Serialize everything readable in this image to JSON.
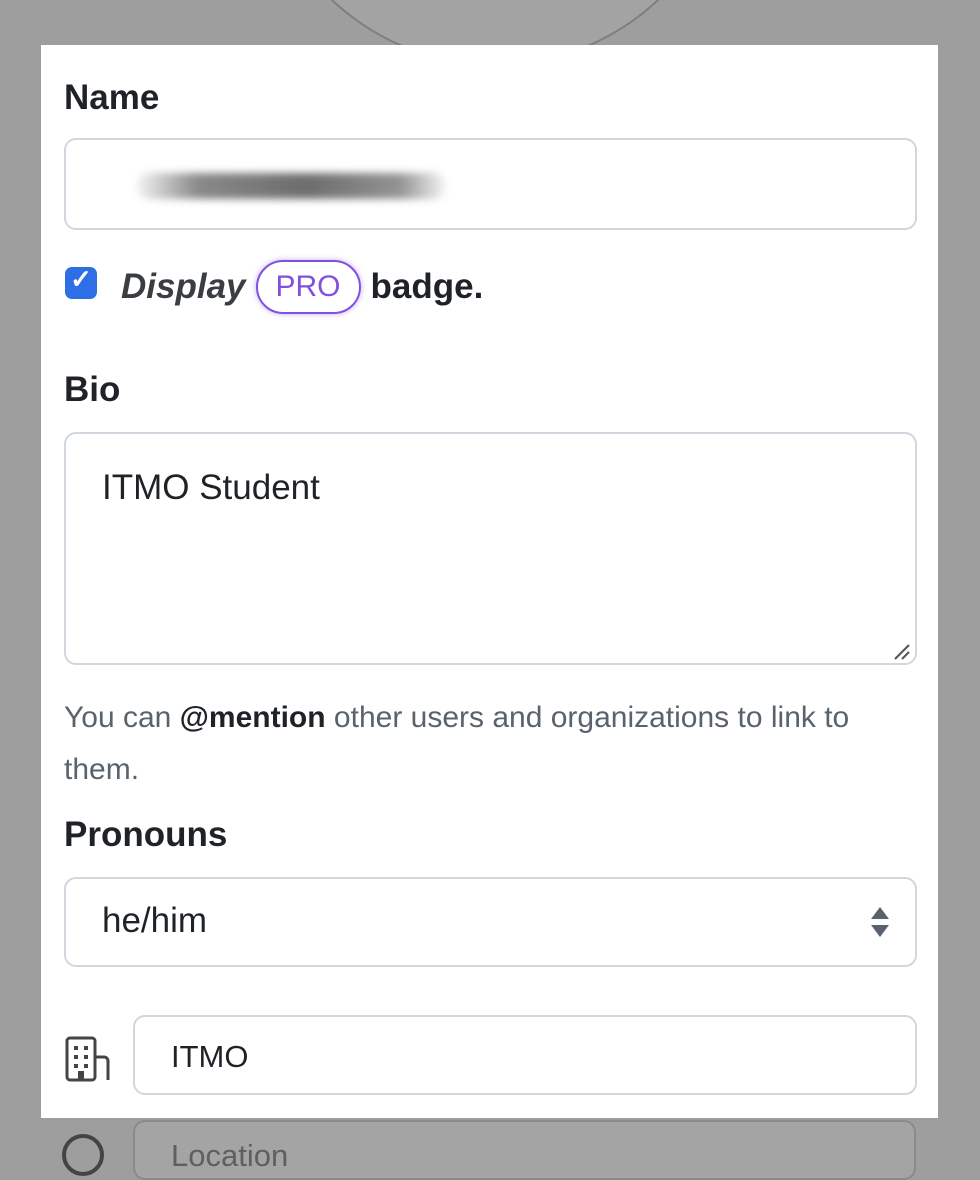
{
  "profile_form": {
    "name": {
      "label": "Name",
      "value_redacted": true
    },
    "display_badge": {
      "checked": true,
      "prefix": "Display",
      "badge": "PRO",
      "suffix": "badge."
    },
    "bio": {
      "label": "Bio",
      "value": "ITMO Student"
    },
    "mention_hint": {
      "before": "You can ",
      "mention": "@mention",
      "after": " other users and organizations to link to them."
    },
    "pronouns": {
      "label": "Pronouns",
      "selected": "he/him"
    },
    "company": {
      "icon": "organization-icon",
      "value": "ITMO"
    },
    "location": {
      "icon": "location-icon",
      "placeholder": "Location"
    }
  },
  "colors": {
    "checkbox_accent": "#2f6fe6",
    "pro_badge": "#8250df",
    "overlay": "#9e9e9e"
  }
}
